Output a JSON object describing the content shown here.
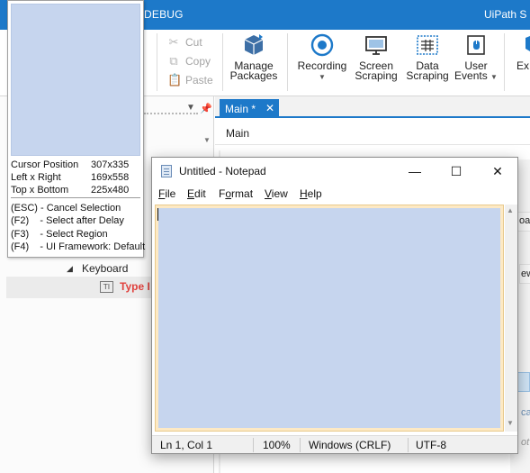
{
  "window": {
    "debug_tab": "DEBUG",
    "app_title": "UiPath S"
  },
  "ribbon": {
    "clipboard": {
      "cut": "Cut",
      "copy": "Copy",
      "paste": "Paste"
    },
    "buttons": [
      {
        "name": "manage-packages",
        "line1": "Manage",
        "line2": "Packages",
        "icon": "package-icon"
      },
      {
        "name": "recording",
        "line1": "Recording",
        "line2": "",
        "dropdown": true,
        "icon": "record-icon"
      },
      {
        "name": "screen-scraping",
        "line1": "Screen",
        "line2": "Scraping",
        "icon": "monitor-icon"
      },
      {
        "name": "data-scraping",
        "line1": "Data",
        "line2": "Scraping",
        "icon": "table-grid-icon"
      },
      {
        "name": "user-events",
        "line1": "User",
        "line2": "Events",
        "dropdown": true,
        "icon": "mouse-keyboard-icon"
      },
      {
        "name": "export",
        "line1": "Ex",
        "line2": "",
        "icon": "export-icon"
      }
    ]
  },
  "left_panel": {
    "tree": {
      "keyboard_label": "Keyboard",
      "type_into_label": "Type I"
    }
  },
  "designer": {
    "tab_label": "Main *",
    "tab_close": "✕",
    "breadcrumb": "Main",
    "fragments": {
      "frag1": "oa",
      "frag2": "ew",
      "frag3": "ca",
      "frag4": "ot"
    }
  },
  "notepad": {
    "title": "Untitled - Notepad",
    "controls": {
      "minimize": "—",
      "maximize": "☐",
      "close": "✕"
    },
    "menu": [
      "File",
      "Edit",
      "Format",
      "View",
      "Help"
    ],
    "menu_mnemonics": [
      "F",
      "E",
      "o",
      "V",
      "H"
    ],
    "status": {
      "position": "Ln 1, Col 1",
      "zoom": "100%",
      "line_endings": "Windows (CRLF)",
      "encoding": "UTF-8"
    }
  },
  "selection_overlay": {
    "info": [
      {
        "label": "Cursor Position",
        "value": "307x335"
      },
      {
        "label": "Left x Right",
        "value": "169x558"
      },
      {
        "label": "Top x Bottom",
        "value": "225x480"
      }
    ],
    "shortcuts": [
      "(ESC) - Cancel Selection",
      "(F2)    - Select after Delay",
      "(F3)    - Select Region",
      "(F4)    - UI Framework: Default"
    ]
  },
  "colors": {
    "accent": "#1d79c9",
    "highlight": "#c6d5ee",
    "selection_border": "#fde9c4",
    "error_text": "#e0413d"
  }
}
